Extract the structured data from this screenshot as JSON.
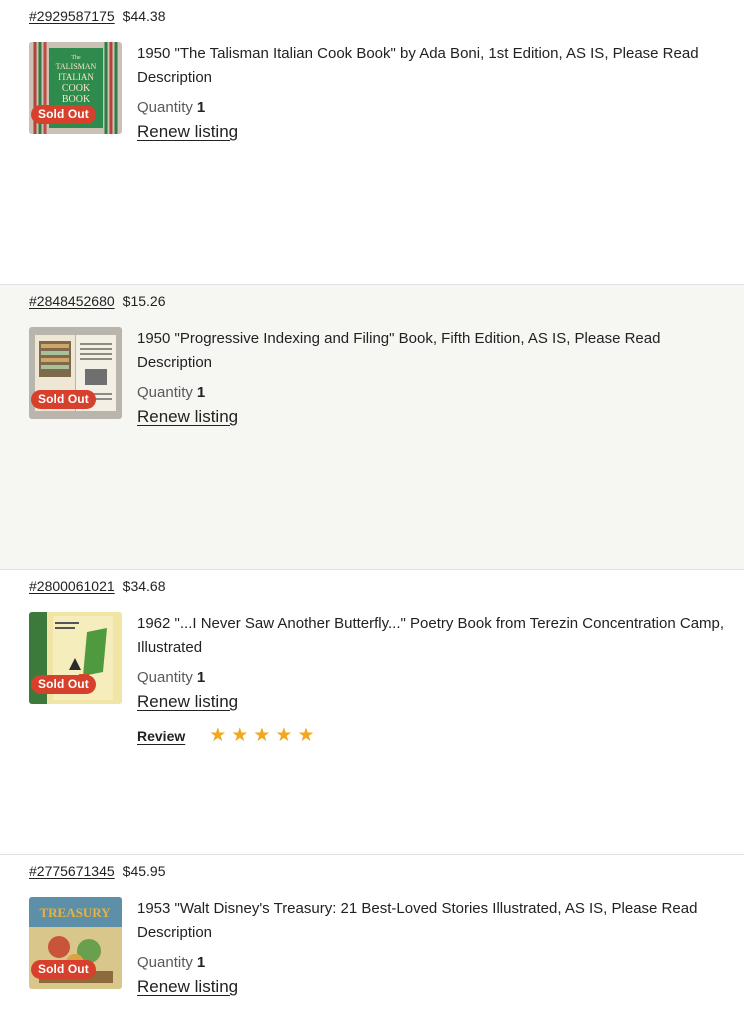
{
  "orders": [
    {
      "id": "#2929587175",
      "price": "$44.38",
      "title": "1950 \"The Talisman Italian Cook Book\" by Ada Boni, 1st Edition, AS IS, Please Read Description",
      "quantity_label": "Quantity",
      "quantity": "1",
      "renew_label": "Renew listing",
      "badge": "Sold Out",
      "thumb_text": [
        "The",
        "TALISMAN",
        "ITALIAN",
        "COOK",
        "BOOK"
      ]
    },
    {
      "id": "#2848452680",
      "price": "$15.26",
      "title": "1950 \"Progressive Indexing and Filing\" Book, Fifth Edition, AS IS, Please Read Description",
      "quantity_label": "Quantity",
      "quantity": "1",
      "renew_label": "Renew listing",
      "badge": "Sold Out"
    },
    {
      "id": "#2800061021",
      "price": "$34.68",
      "title": "1962 \"...I Never Saw Another Butterfly...\" Poetry Book from Terezin Concentration Camp, Illustrated",
      "quantity_label": "Quantity",
      "quantity": "1",
      "renew_label": "Renew listing",
      "badge": "Sold Out",
      "review_label": "Review",
      "rating": 5
    },
    {
      "id": "#2775671345",
      "price": "$45.95",
      "title": "1953 \"Walt Disney's Treasury: 21 Best-Loved Stories Illustrated, AS IS, Please Read Description",
      "quantity_label": "Quantity",
      "quantity": "1",
      "renew_label": "Renew listing",
      "badge": "Sold Out",
      "thumb_text": [
        "TREASURY"
      ]
    }
  ],
  "colors": {
    "badge": "#d6402c",
    "star": "#f1a81e",
    "shaded_row": "#f6f6f3"
  }
}
